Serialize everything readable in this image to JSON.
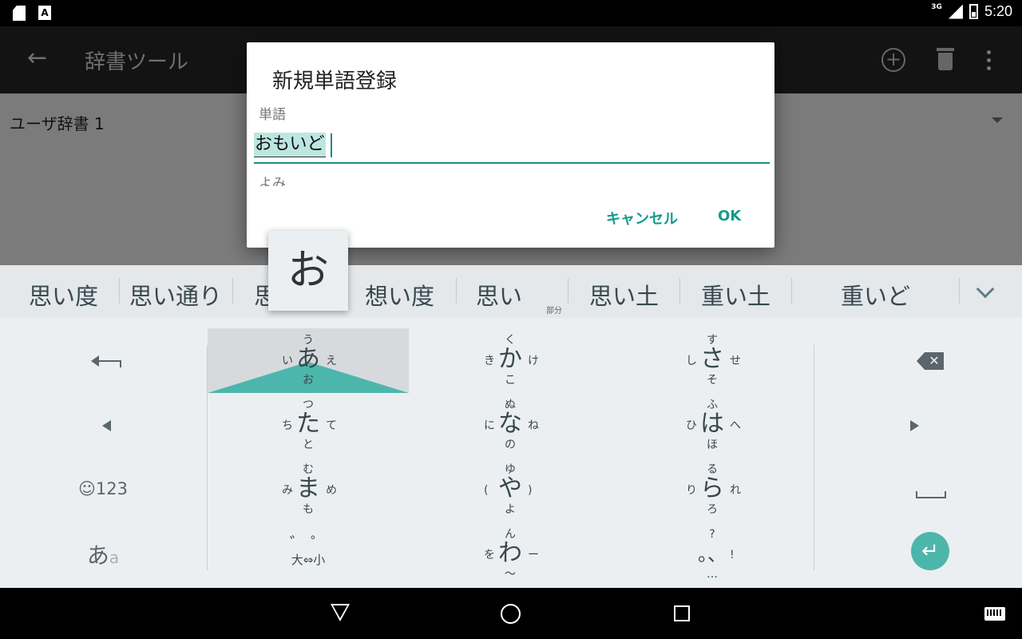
{
  "status_bar": {
    "network": "3G",
    "time": "5:20"
  },
  "app": {
    "back_icon": "arrow-back-icon",
    "title": "辞書ツール",
    "dictionary_name": "ユーザ辞書 1",
    "actions": [
      "add-circle-icon",
      "trash-icon",
      "more-vert-icon"
    ]
  },
  "dialog": {
    "title": "新規単語登録",
    "word_label": "単語",
    "word_value": "おもいど",
    "reading_label": "よみ",
    "cancel_label": "キャンセル",
    "ok_label": "OK"
  },
  "key_preview": "お",
  "candidates": {
    "items": [
      "思い度",
      "思い通り",
      "思",
      "想い度",
      "思い",
      "思い土",
      "重い土",
      "重いど"
    ],
    "part_label": "部分"
  },
  "keyboard": {
    "kana_keys": [
      {
        "main": "あ",
        "up": "う",
        "left": "い",
        "right": "え",
        "down": "お"
      },
      {
        "main": "か",
        "up": "く",
        "left": "き",
        "right": "け",
        "down": "こ"
      },
      {
        "main": "さ",
        "up": "す",
        "left": "し",
        "right": "せ",
        "down": "そ"
      },
      {
        "main": "た",
        "up": "つ",
        "left": "ち",
        "right": "て",
        "down": "と"
      },
      {
        "main": "な",
        "up": "ぬ",
        "left": "に",
        "right": "ね",
        "down": "の"
      },
      {
        "main": "は",
        "up": "ふ",
        "left": "ひ",
        "right": "へ",
        "down": "ほ"
      },
      {
        "main": "ま",
        "up": "む",
        "left": "み",
        "right": "め",
        "down": "も"
      },
      {
        "main": "や",
        "up": "ゆ",
        "left": "(",
        "right": ")",
        "down": "よ"
      },
      {
        "main": "ら",
        "up": "る",
        "left": "り",
        "right": "れ",
        "down": "ろ"
      },
      {
        "main": "わ",
        "up": "ん",
        "left": "を",
        "right": "ー",
        "down": "〜"
      }
    ],
    "dakuten_label": "゛ ゜",
    "size_swap_label": "大⇔小",
    "punct": {
      "main": "。、",
      "up": "?",
      "right": "!",
      "down": "…"
    },
    "emoji_label": "☺123",
    "mode_label": "あ",
    "mode_label_small": "a",
    "backspace_glyph": "✕",
    "enter_glyph": "↵"
  }
}
